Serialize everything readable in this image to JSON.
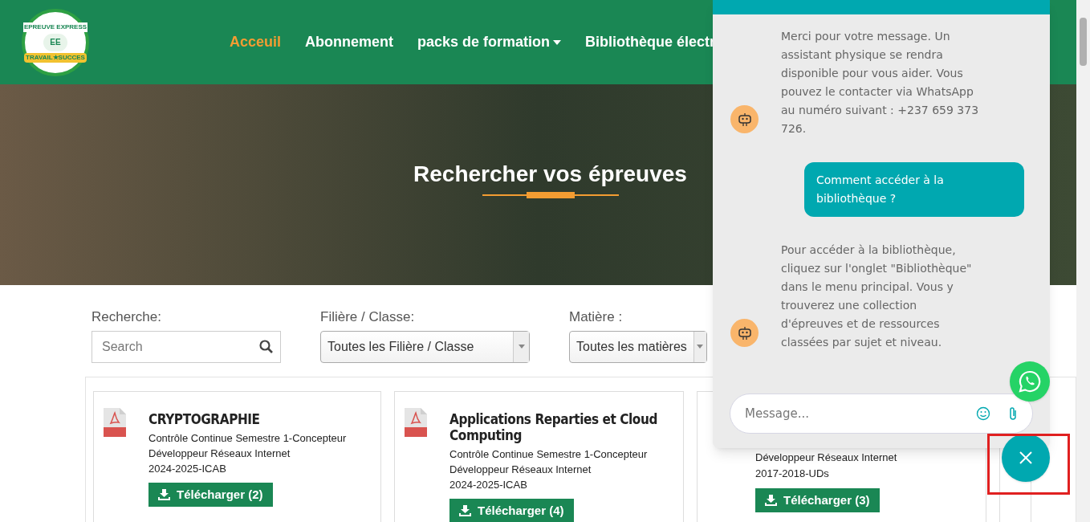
{
  "header": {
    "logo": {
      "top_text": "EPREUVE EXPRESS",
      "initials": "EE",
      "bottom_text": "TRAVAIL★SUCCES"
    },
    "nav": [
      {
        "label": "Acceuil",
        "selected": true,
        "dropdown": false
      },
      {
        "label": "Abonnement",
        "selected": false,
        "dropdown": false
      },
      {
        "label": "packs de formation",
        "selected": false,
        "dropdown": true
      },
      {
        "label": "Bibliothèque électr",
        "selected": false,
        "dropdown": false
      }
    ]
  },
  "hero": {
    "title": "Rechercher vos épreuves"
  },
  "filters": [
    {
      "kind": "search",
      "label": "Recherche:",
      "placeholder": "Search"
    },
    {
      "kind": "select",
      "label": "Filière / Classe:",
      "value": "Toutes les Filière / Classe"
    },
    {
      "kind": "select",
      "label": "Matière :",
      "value": "Toutes les matières"
    }
  ],
  "cards": [
    {
      "title": "CRYPTOGRAPHIE",
      "lines": [
        "Contrôle Continue Semestre 1-Concepteur",
        "Développeur Réseaux Internet",
        "2024-2025-ICAB"
      ],
      "button": "Télécharger (2)"
    },
    {
      "title": "Applications Reparties et Cloud Computing",
      "lines": [
        "Contrôle Continue Semestre 1-Concepteur",
        "Développeur Réseaux Internet",
        "2024-2025-ICAB"
      ],
      "button": "Télécharger (4)"
    },
    {
      "lines": [
        "Développeur Réseaux Internet",
        "2017-2018-UDs"
      ],
      "button": "Télécharger (3)"
    }
  ],
  "chat": {
    "messages": [
      {
        "kind": "bot",
        "text": "Merci pour votre message. Un assistant physique se rendra disponible pour vous aider. Vous pouvez le contacter via WhatsApp au numéro suivant : +237 659 373 726."
      },
      {
        "kind": "user",
        "text": "Comment accéder à la bibliothèque ?"
      },
      {
        "kind": "bot",
        "text": "Pour accéder à la bibliothèque, cliquez sur l'onglet \"Bibliothèque\" dans le menu principal. Vous y trouverez une collection d'épreuves et de ressources classées par sujet et niveau."
      }
    ],
    "input": {
      "placeholder": "Message..."
    }
  }
}
